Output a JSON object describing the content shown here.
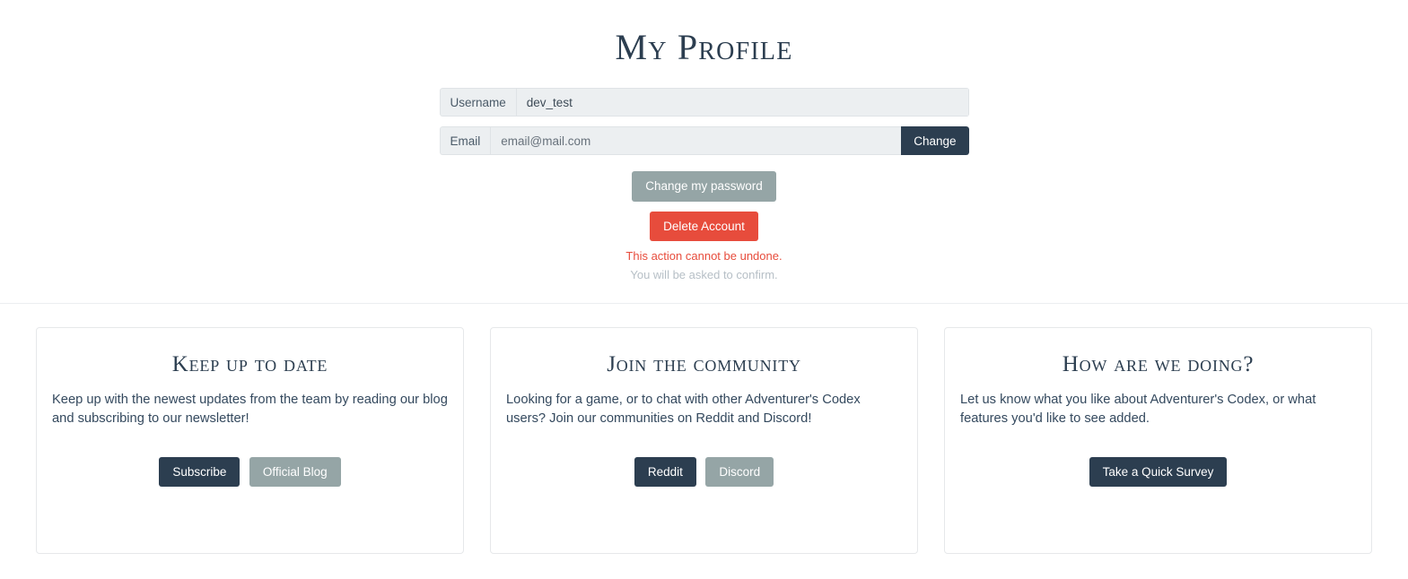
{
  "page": {
    "title": "My Profile"
  },
  "profile": {
    "username": {
      "label": "Username",
      "value": "dev_test"
    },
    "email": {
      "label": "Email",
      "value": "email@mail.com",
      "change_button": "Change"
    },
    "change_password_button": "Change my password",
    "delete_account_button": "Delete Account",
    "warning_text": "This action cannot be undone.",
    "confirm_text": "You will be asked to confirm."
  },
  "cards": [
    {
      "title": "Keep up to date",
      "body": "Keep up with the newest updates from the team by reading our blog and subscribing to our newsletter!",
      "primary_button": "Subscribe",
      "secondary_button": "Official Blog"
    },
    {
      "title": "Join the community",
      "body": "Looking for a game, or to chat with other Adventurer's Codex users? Join our communities on Reddit and Discord!",
      "primary_button": "Reddit",
      "secondary_button": "Discord"
    },
    {
      "title": "How are we doing?",
      "body": "Let us know what you like about Adventurer's Codex, or what features you'd like to see added.",
      "primary_button": "Take a Quick Survey",
      "secondary_button": null
    }
  ],
  "colors": {
    "dark": "#2c3e50",
    "secondary": "#95a5a6",
    "danger": "#e74c3c",
    "text": "#34495e",
    "muted": "#b6bfc6",
    "field_bg": "#eceff1"
  }
}
